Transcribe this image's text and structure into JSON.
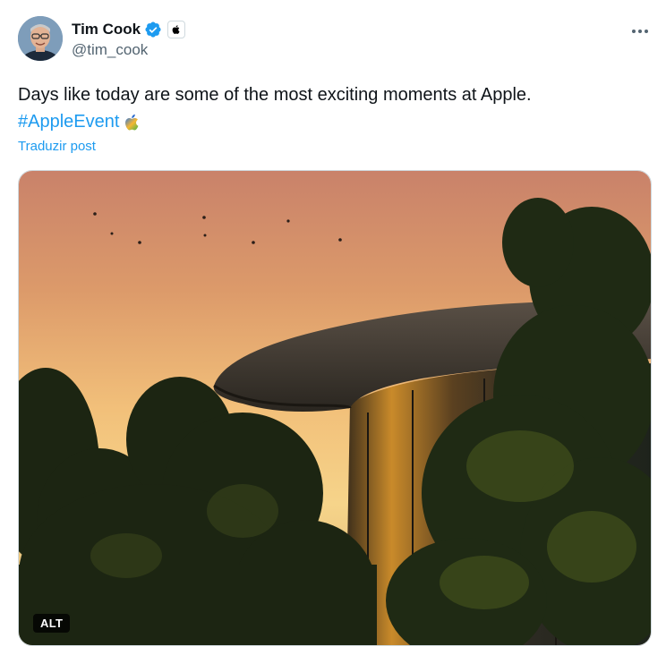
{
  "author": {
    "display_name": "Tim Cook",
    "handle": "@tim_cook",
    "verified": true,
    "verified_color": "#1d9bf0",
    "affiliation_icon": "apple-logo-icon"
  },
  "tweet": {
    "text": "Days like today are some of the most exciting moments at Apple.",
    "hashtag": "#AppleEvent",
    "hashflag_icon": "apple-event-hashflag-icon",
    "translate_label": "Traduzir post"
  },
  "media": {
    "alt_label": "ALT"
  },
  "colors": {
    "link": "#1d9bf0",
    "text": "#0f1419",
    "secondary": "#536471"
  }
}
